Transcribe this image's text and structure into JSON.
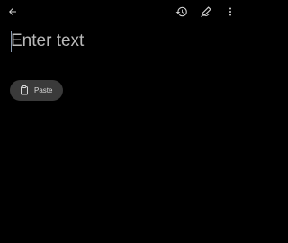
{
  "toolbar": {
    "back_icon": "arrow-back-icon",
    "history_icon": "history-icon",
    "handwriting_icon": "pen-scribble-icon",
    "more_icon": "more-vertical-icon"
  },
  "editor": {
    "placeholder": "Enter text",
    "value": ""
  },
  "paste_chip": {
    "icon": "clipboard-icon",
    "label": "Paste"
  },
  "colors": {
    "background": "#000000",
    "icon": "#d0d0d0",
    "chip_background": "#3a3a3a",
    "cursor": "#8a9bb0"
  }
}
